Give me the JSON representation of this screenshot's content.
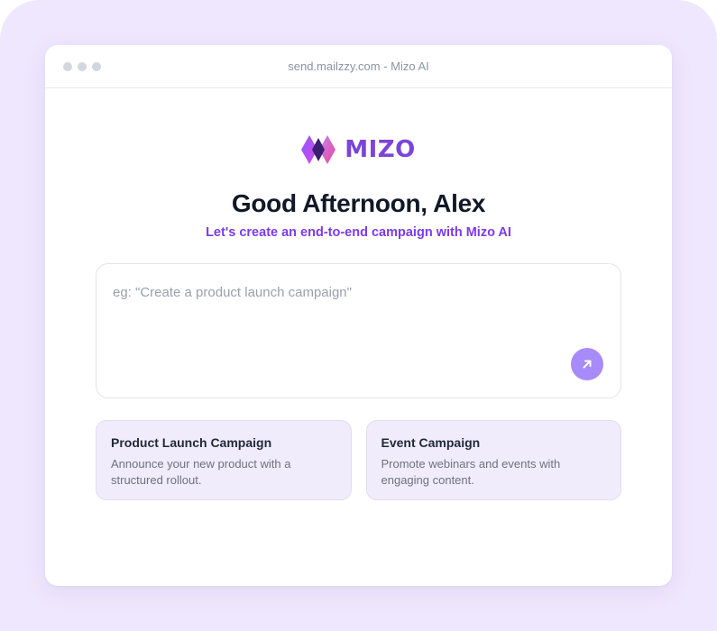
{
  "browser": {
    "url": "send.mailzzy.com - Mizo AI"
  },
  "brand": {
    "name": "MIZO",
    "color": "#7b45d6"
  },
  "hero": {
    "greeting": "Good Afternoon, Alex",
    "subtitle": "Let's create an end-to-end campaign with Mizo AI"
  },
  "prompt": {
    "placeholder": "eg: \"Create a product launch campaign\"",
    "value": "",
    "send_icon": "arrow-up-right-icon"
  },
  "suggestions": [
    {
      "title": "Product Launch Campaign",
      "description": "Announce your new product with a structured rollout."
    },
    {
      "title": "Event Campaign",
      "description": "Promote webinars and events with engaging content."
    }
  ],
  "colors": {
    "accent": "#7c3aed",
    "send_button": "#a78bfa",
    "card_background": "#f1ecfb",
    "page_background": "#efe7fd"
  }
}
